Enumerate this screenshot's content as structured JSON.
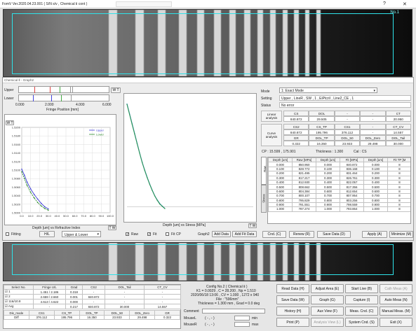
{
  "window": {
    "title": "FomV Ver.2020.04.23.001 ( S/N s/v , Chemical Ⅱ cont )",
    "help_icon": "?",
    "close_icon": "✕"
  },
  "camera_top": {
    "no_label": "No.1"
  },
  "subwindow": {
    "title": "Chemical Ⅱ - Graph2"
  },
  "fringe": {
    "upper_label": "Upper",
    "lower_label": "Lower",
    "toggle_label": "W T",
    "ticks": [
      "0.000",
      "2.000",
      "4.000",
      "6.000"
    ],
    "xlabel": "Fringe Position [mm]"
  },
  "graph_left": {
    "toggle_label": "W T",
    "legend": [
      "Upper",
      "Lower"
    ],
    "xlabel": "Depth [um] vs Refractive Index",
    "yticks": [
      "1.5200",
      "1.5180",
      "1.5160",
      "1.5140",
      "1.5120",
      "1.5100",
      "1.5080",
      "1.5060",
      "1.5040",
      "1.5020",
      "1.5000"
    ],
    "xticks": [
      "0.0",
      "10.0",
      "20.0",
      "30.0",
      "40.0",
      "50.0",
      "60.0",
      "70.0",
      "80.0",
      "90.0",
      "100.0"
    ],
    "tw_label": "T W"
  },
  "graph_right": {
    "xlabel": "Depth [um] vs Stress [MPa]",
    "tw_label": "T W"
  },
  "left_controls": {
    "fitting_label": "Fitting",
    "hl_button": "H/L",
    "combo_value": "Upper & Lower"
  },
  "right_graph_controls": {
    "raw_label": "Raw",
    "fit_label": "Fit",
    "fit_cp_label": "Fit CP",
    "graph_label": "Graph2",
    "add_data_button": "Add Data",
    "add_fit_data_button": "Add Fit Data"
  },
  "panel": {
    "mode_label": "Mode",
    "mode_value": "1: Exact Mode",
    "setting_label": "Setting",
    "setting_value": "Upper , LineR , SW , 1 , EiPtcriI , Line2_CE , 1",
    "status_label": "Status",
    "status_value": "No error",
    "linear_label": "Linear analysis",
    "linear_headers": [
      "CS",
      "DOL",
      "-",
      "-",
      "CT"
    ],
    "linear_values": [
      "840.872",
      "29.505",
      "-",
      "-",
      "20.950"
    ],
    "curve_label": "Curve analysis",
    "curve_headers1": [
      "CS2",
      "CS_TP",
      "CS1",
      "-",
      "CT_CV"
    ],
    "curve_values1": [
      "840.872",
      "195.796",
      "376.112",
      "-",
      "14.557"
    ],
    "curve_headers2": [
      "GR",
      "DOL_TP",
      "DOL_50",
      "DOL_Zero",
      "DOL_Tail"
    ],
    "curve_values2": [
      "0.322",
      "16.350",
      "23.933",
      "29.498",
      "30.000"
    ],
    "cp_text": "CP : 15.599 , 175.901",
    "thickness_text": "Thickness : 1.300",
    "cal_text": "Cal : CS",
    "side_tab_raw": "Raw",
    "side_tab_stress": "Stress",
    "table_headers": [
      "Depth [um]",
      "Raw [MPa]",
      "Depth [um]",
      "Fit [MPa]",
      "Depth [um]",
      "Fit TP [M"
    ],
    "table_rows": [
      [
        "0.000",
        "850.950",
        "0.000",
        "840.872",
        "0.000",
        "8"
      ],
      [
        "0.100",
        "828.772",
        "0.100",
        "836.168",
        "0.100",
        "8"
      ],
      [
        "0.200",
        "821.495",
        "0.200",
        "831.464",
        "0.200",
        "8"
      ],
      [
        "0.300",
        "817.217",
        "0.300",
        "826.761",
        "0.300",
        "8"
      ],
      [
        "0.400",
        "812.930",
        "0.400",
        "822.057",
        "0.400",
        "8"
      ],
      [
        "0.500",
        "808.662",
        "0.500",
        "817.356",
        "0.500",
        "8"
      ],
      [
        "0.600",
        "804.384",
        "0.600",
        "812.654",
        "0.600",
        "8"
      ],
      [
        "0.700",
        "800.107",
        "0.700",
        "807.954",
        "0.700",
        "8"
      ],
      [
        "0.800",
        "795.829",
        "0.800",
        "803.256",
        "0.800",
        "8"
      ],
      [
        "0.900",
        "791.551",
        "0.900",
        "798.559",
        "0.900",
        "8"
      ],
      [
        "1.000",
        "787.274",
        "1.000",
        "793.864",
        "1.000",
        "8"
      ]
    ]
  },
  "bottom_buttons": {
    "cnd": "Cnd. (C)",
    "renew": "Renew (R)",
    "save_data": "Save Data (D)",
    "apply": "Apply (A)",
    "minimize": "Minimize (M)"
  },
  "results": {
    "headers": [
      "Select No.",
      "Fringe U/L",
      "Grad",
      "CS2",
      "DOL_Tail",
      "CT_CV"
    ],
    "rows": [
      {
        "check": "☑",
        "no": "1",
        "fringe": "1.451 / 2.186",
        "grad": "0.318",
        "cs2": "-",
        "dol_tail": "-",
        "ct_cv": "-"
      },
      {
        "check": "☑",
        "no": "2",
        "fringe": "2.659 / 2.660",
        "grad": "0.001",
        "cs2": "840.872",
        "dol_tail": "-",
        "ct_cv": "-"
      },
      {
        "check": "☑",
        "no": "11&/10.8",
        "fringe": "4.613 / 4.622",
        "grad": "0.000",
        "cs2": "-",
        "dol_tail": "-",
        "ct_cv": "-"
      },
      {
        "check": "☑",
        "no": "Avg",
        "fringe": "-",
        "grad": "0.217",
        "cs2": "840.872",
        "dol_tail": "30.000",
        "ct_cv": "14.557"
      }
    ],
    "headers2": [
      "Dis_mode",
      "CS1",
      "CS_TP",
      "DOL_TP",
      "DOL_50",
      "DOL_Zero",
      "GR"
    ],
    "row2": [
      "Diff",
      "376.112",
      "195.796",
      "16.350",
      "23.933",
      "29.498",
      "0.322"
    ]
  },
  "config": {
    "line1": "Config No.2 ( Chemical Ⅱ )",
    "line2": "K1 = 0.0029 , C = 28.200 , Np = 1.510",
    "line3": "2020/06/18 13:06 , CV = 1.000 , 1272 x 940",
    "line4": "File : \"596mm\"",
    "line5": "Thickness = 1.300 mm , Grad = 0.0 deg",
    "comment_label": "Comment",
    "mouse_label": "MouseL",
    "mouse_r_label": "MouseR",
    "mouse_val": "( - , - )",
    "min_label": "min",
    "max_label": "max"
  },
  "action_buttons": [
    [
      "Read Data (H)",
      "Adjust Area (E)",
      "Start Live (B)",
      "Cath Meas (A)"
    ],
    [
      "Save Data (W)",
      "Graph (G)",
      "Capture (I)",
      "Auto Meas (N)"
    ],
    [
      "History (H)",
      "Aux View (F)",
      "Meas. Cnd. (C)",
      "Manual Meas. (M)"
    ],
    [
      "Print (P)",
      "Analysis View (L)",
      "System Cnd. (S)",
      "Exit (X)"
    ]
  ],
  "action_disabled": [
    "Cath Meas (A)",
    "Analysis View (L)"
  ],
  "chart_data": [
    {
      "type": "line",
      "title": "",
      "xlabel": "Depth [um] vs Refractive Index",
      "ylabel": "",
      "xlim": [
        0,
        100
      ],
      "ylim": [
        1.5,
        1.52
      ],
      "grid": true,
      "legend_position": "top-right",
      "series": [
        {
          "name": "Upper",
          "color": "#3b3bd6",
          "x": [
            0,
            3,
            6,
            10,
            14,
            18,
            22,
            26,
            30
          ],
          "y": [
            1.5102,
            1.5088,
            1.5072,
            1.5056,
            1.5043,
            1.5032,
            1.5022,
            1.5014,
            1.5009
          ]
        },
        {
          "name": "Lower",
          "color": "#2a8a2a",
          "x": [
            0,
            3,
            6,
            10,
            14,
            18,
            22,
            26,
            30
          ],
          "y": [
            1.5096,
            1.508,
            1.5064,
            1.5048,
            1.5035,
            1.5024,
            1.5016,
            1.501,
            1.5006
          ]
        }
      ]
    },
    {
      "type": "line",
      "title": "",
      "xlabel": "Depth [um] vs Stress [MPa]",
      "ylabel": "",
      "xlim": [
        0,
        100
      ],
      "ylim": [
        -100,
        900
      ],
      "grid": false,
      "series": [
        {
          "name": "",
          "color": "#2a7ab0",
          "x": [
            0,
            2,
            4,
            6,
            8,
            10,
            12,
            14,
            16,
            18,
            20,
            22,
            24,
            26,
            28,
            30
          ],
          "y": [
            840,
            760,
            680,
            600,
            520,
            440,
            365,
            300,
            240,
            185,
            135,
            90,
            55,
            25,
            5,
            -14
          ]
        },
        {
          "name": "",
          "color": "#2a9a4a",
          "x": [
            0,
            2,
            4,
            6,
            8,
            10,
            12,
            14,
            16,
            18,
            20,
            22,
            24,
            26,
            28,
            30
          ],
          "y": [
            836,
            755,
            675,
            596,
            516,
            438,
            362,
            298,
            238,
            183,
            133,
            88,
            52,
            22,
            3,
            -15
          ]
        }
      ]
    }
  ]
}
